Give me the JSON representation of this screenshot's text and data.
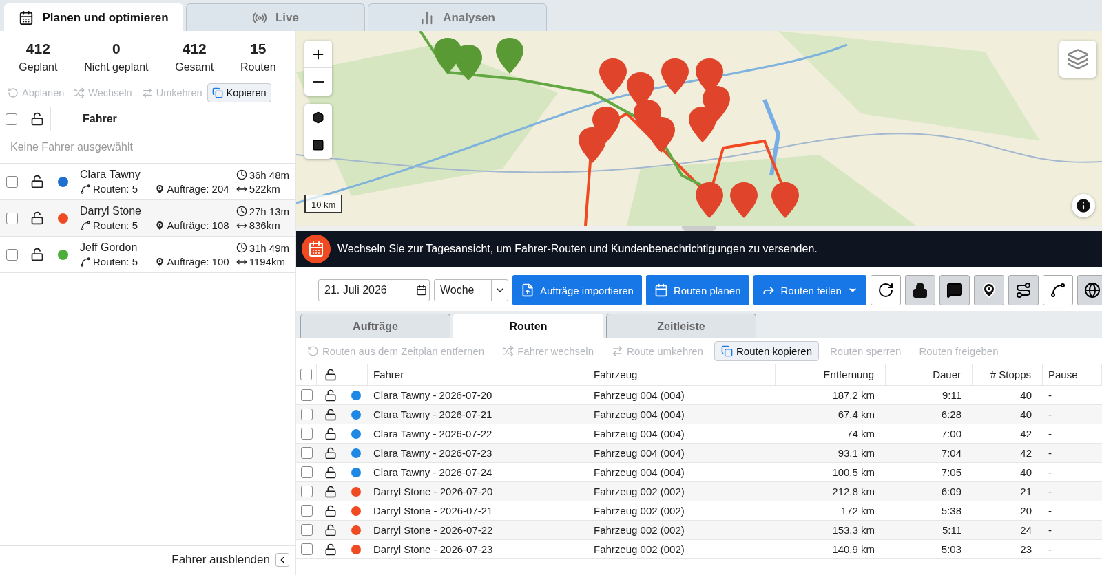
{
  "top_tabs": [
    {
      "label": "Planen und optimieren",
      "selected": true
    },
    {
      "label": "Live",
      "selected": false
    },
    {
      "label": "Analysen",
      "selected": false
    }
  ],
  "stats": [
    {
      "value": "412",
      "label": "Geplant"
    },
    {
      "value": "0",
      "label": "Nicht geplant"
    },
    {
      "value": "412",
      "label": "Gesamt"
    },
    {
      "value": "15",
      "label": "Routen"
    }
  ],
  "driver_actions": [
    {
      "label": "Abplanen",
      "disabled": true
    },
    {
      "label": "Wechseln",
      "disabled": true
    },
    {
      "label": "Umkehren",
      "disabled": true
    },
    {
      "label": "Kopieren",
      "disabled": false
    }
  ],
  "driver_table": {
    "select_all_checked": false,
    "column": "Fahrer",
    "empty_note": "Keine Fahrer ausgewählt",
    "rows": [
      {
        "name": "Clara Tawny",
        "checked": false,
        "color": "#1f6fd0",
        "routes": "Routen: 5",
        "orders": "Aufträge: 204",
        "time": "36h 48m",
        "distance": "522km"
      },
      {
        "name": "Darryl Stone",
        "checked": false,
        "color": "#f04a23",
        "routes": "Routen: 5",
        "orders": "Aufträge: 108",
        "time": "27h 13m",
        "distance": "836km"
      },
      {
        "name": "Jeff Gordon",
        "checked": false,
        "color": "#4caf3a",
        "routes": "Routen: 5",
        "orders": "Aufträge: 100",
        "time": "31h 49m",
        "distance": "1194km"
      }
    ]
  },
  "hide_drivers": "Fahrer ausblenden",
  "map": {
    "kind": "picture",
    "scale": "10 km"
  },
  "banner": "Wechseln Sie zur Tagesansicht, um Fahrer-Routen und Kundenbenachrichtigungen zu versenden.",
  "toolbar": {
    "date": "21. Juli 2026",
    "period": "Woche",
    "buttons": [
      {
        "label": "Aufträge importieren"
      },
      {
        "label": "Routen planen"
      },
      {
        "label": "Routen teilen"
      }
    ]
  },
  "view_tabs": [
    {
      "label": "Aufträge",
      "selected": false
    },
    {
      "label": "Routen",
      "selected": true
    },
    {
      "label": "Zeitleiste",
      "selected": false
    }
  ],
  "route_actions": [
    {
      "label": "Routen aus dem Zeitplan entfernen",
      "disabled": true
    },
    {
      "label": "Fahrer wechseln",
      "disabled": true
    },
    {
      "label": "Route umkehren",
      "disabled": true
    },
    {
      "label": "Routen kopieren",
      "disabled": false
    },
    {
      "label": "Routen sperren",
      "disabled": true
    },
    {
      "label": "Routen freigeben",
      "disabled": true
    }
  ],
  "routes_table": {
    "select_all_checked": false,
    "columns": [
      "Fahrer",
      "Fahrzeug",
      "Entfernung",
      "Dauer",
      "# Stopps",
      "Pause"
    ],
    "rows": [
      {
        "checked": false,
        "color": "#1e88e5",
        "driver": "Clara Tawny - 2026-07-20",
        "vehicle": "Fahrzeug 004 (004)",
        "distance": "187.2 km",
        "duration": "9:11",
        "stops": "40",
        "pause": "-"
      },
      {
        "checked": false,
        "color": "#1e88e5",
        "driver": "Clara Tawny - 2026-07-21",
        "vehicle": "Fahrzeug 004 (004)",
        "distance": "67.4 km",
        "duration": "6:28",
        "stops": "40",
        "pause": "-"
      },
      {
        "checked": false,
        "color": "#1e88e5",
        "driver": "Clara Tawny - 2026-07-22",
        "vehicle": "Fahrzeug 004 (004)",
        "distance": "74 km",
        "duration": "7:00",
        "stops": "42",
        "pause": "-"
      },
      {
        "checked": false,
        "color": "#1e88e5",
        "driver": "Clara Tawny - 2026-07-23",
        "vehicle": "Fahrzeug 004 (004)",
        "distance": "93.1 km",
        "duration": "7:04",
        "stops": "42",
        "pause": "-"
      },
      {
        "checked": false,
        "color": "#1e88e5",
        "driver": "Clara Tawny - 2026-07-24",
        "vehicle": "Fahrzeug 004 (004)",
        "distance": "100.5 km",
        "duration": "7:05",
        "stops": "40",
        "pause": "-"
      },
      {
        "checked": false,
        "color": "#f04a23",
        "driver": "Darryl Stone - 2026-07-20",
        "vehicle": "Fahrzeug 002 (002)",
        "distance": "212.8 km",
        "duration": "6:09",
        "stops": "21",
        "pause": "-"
      },
      {
        "checked": false,
        "color": "#f04a23",
        "driver": "Darryl Stone - 2026-07-21",
        "vehicle": "Fahrzeug 002 (002)",
        "distance": "172 km",
        "duration": "5:38",
        "stops": "20",
        "pause": "-"
      },
      {
        "checked": false,
        "color": "#f04a23",
        "driver": "Darryl Stone - 2026-07-22",
        "vehicle": "Fahrzeug 002 (002)",
        "distance": "153.3 km",
        "duration": "5:11",
        "stops": "24",
        "pause": "-"
      },
      {
        "checked": false,
        "color": "#f04a23",
        "driver": "Darryl Stone - 2026-07-23",
        "vehicle": "Fahrzeug 002 (002)",
        "distance": "140.9 km",
        "duration": "5:03",
        "stops": "23",
        "pause": "-"
      }
    ]
  }
}
